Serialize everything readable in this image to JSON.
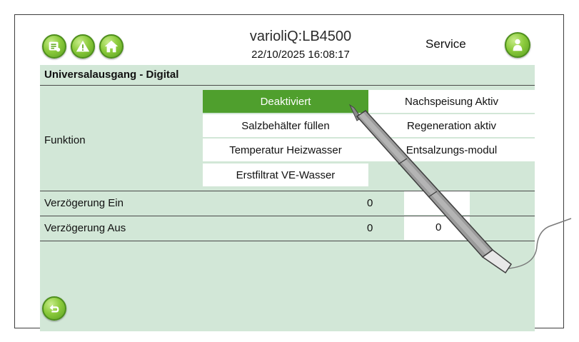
{
  "header": {
    "title": "varioliQ:LB4500",
    "datetime": "22/10/2025 16:08:17",
    "mode": "Service",
    "icons": [
      "list-icon",
      "warning-icon",
      "home-icon",
      "user-icon"
    ]
  },
  "section_title": "Universalausgang - Digital",
  "funktion": {
    "label": "Funktion",
    "options": [
      {
        "label": "Deaktiviert",
        "active": true
      },
      {
        "label": "Nachspeisung Aktiv",
        "active": false
      },
      {
        "label": "Salzbehälter füllen",
        "active": false
      },
      {
        "label": "Regeneration aktiv",
        "active": false
      },
      {
        "label": "Temperatur Heizwasser",
        "active": false
      },
      {
        "label": "Entsalzungs-modul",
        "active": false
      },
      {
        "label": "Erstfiltrat VE-Wasser",
        "active": false
      }
    ]
  },
  "rows": [
    {
      "label": "Verzögerung Ein",
      "value": "0",
      "input": "0"
    },
    {
      "label": "Verzögerung Aus",
      "value": "0",
      "input": "0"
    }
  ],
  "colors": {
    "background": "#d2e7d7",
    "accent_active": "#4f9f2d",
    "button_green": "#8ccb3c"
  }
}
